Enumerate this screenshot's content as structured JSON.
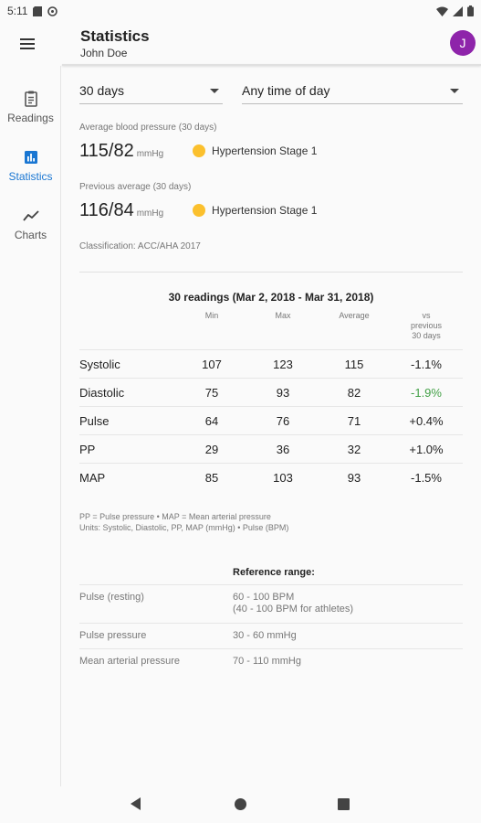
{
  "status_bar": {
    "time": "5:11"
  },
  "app_bar": {
    "title": "Statistics",
    "subtitle": "John Doe",
    "avatar_initial": "J",
    "avatar_color": "#8e24aa"
  },
  "nav": {
    "items": [
      {
        "label": "Readings",
        "icon": "clipboard-icon"
      },
      {
        "label": "Statistics",
        "icon": "bar-chart-icon",
        "active": true
      },
      {
        "label": "Charts",
        "icon": "line-chart-icon"
      }
    ],
    "active_color": "#1976d2"
  },
  "filters": {
    "range": "30 days",
    "time_of_day": "Any time of day"
  },
  "average": {
    "caption": "Average blood pressure (30 days)",
    "value": "115/82",
    "unit": "mmHg",
    "classification": "Hypertension Stage 1"
  },
  "previous": {
    "caption": "Previous average (30 days)",
    "value": "116/84",
    "unit": "mmHg",
    "classification": "Hypertension Stage 1"
  },
  "classification_note": "Classification: ACC/AHA 2017",
  "badge_color": "#fbc02d",
  "table": {
    "title": "30 readings (Mar 2, 2018 - Mar 31, 2018)",
    "headers": {
      "min": "Min",
      "max": "Max",
      "average": "Average",
      "vs_line1": "vs",
      "vs_line2": "previous",
      "vs_line3": "30 days"
    },
    "rows": [
      {
        "label": "Systolic",
        "min": "107",
        "max": "123",
        "avg": "115",
        "vs": "-1.1%"
      },
      {
        "label": "Diastolic",
        "min": "75",
        "max": "93",
        "avg": "82",
        "vs": "-1.9%"
      },
      {
        "label": "Pulse",
        "min": "64",
        "max": "76",
        "avg": "71",
        "vs": "+0.4%"
      },
      {
        "label": "PP",
        "min": "29",
        "max": "36",
        "avg": "32",
        "vs": "+1.0%"
      },
      {
        "label": "MAP",
        "min": "85",
        "max": "103",
        "avg": "93",
        "vs": "-1.5%"
      }
    ],
    "highlight_color": "#43a047"
  },
  "notes": {
    "line1": "PP = Pulse pressure • MAP = Mean arterial pressure",
    "line2": "Units: Systolic, Diastolic, PP, MAP (mmHg) • Pulse (BPM)"
  },
  "reference": {
    "heading": "Reference range:",
    "rows": [
      {
        "label": "Pulse (resting)",
        "value1": "60 - 100 BPM",
        "value2": "(40 - 100 BPM for athletes)"
      },
      {
        "label": "Pulse pressure",
        "value1": "30 - 60 mmHg"
      },
      {
        "label": "Mean arterial pressure",
        "value1": "70 - 110 mmHg"
      }
    ]
  }
}
